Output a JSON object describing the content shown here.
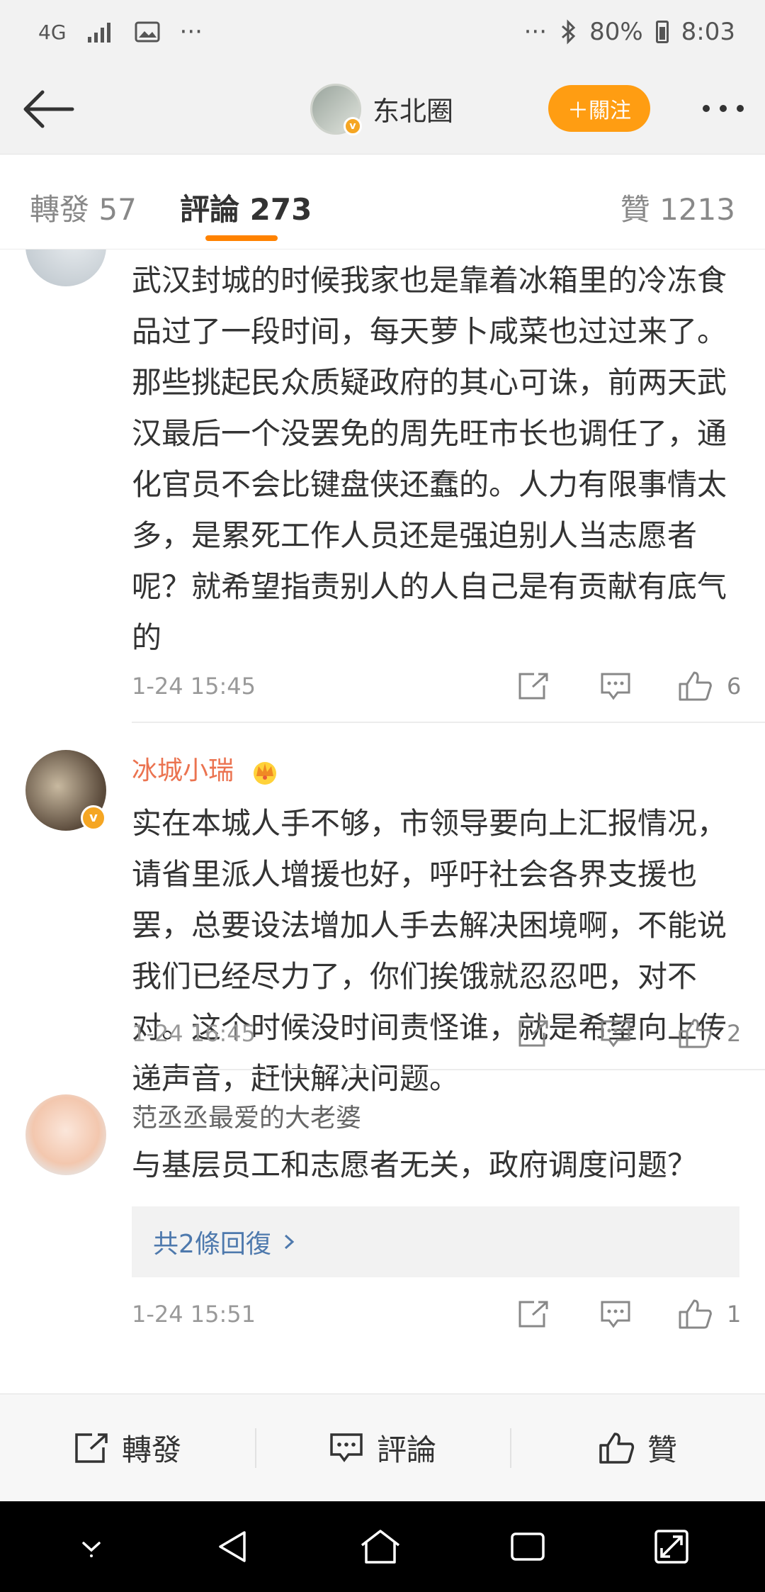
{
  "status_bar": {
    "network": "4G",
    "more_left": "···",
    "more_right": "···",
    "battery": "80%",
    "time": "8:03"
  },
  "header": {
    "group_name": "东北圈",
    "follow_label": "＋關注"
  },
  "tabs": [
    {
      "label": "轉發 57"
    },
    {
      "label": "評論 273"
    },
    {
      "label": "贊 1213"
    }
  ],
  "comments": [
    {
      "username": "",
      "text": "武汉封城的时候我家也是靠着冰箱里的冷冻食品过了一段时间，每天萝卜咸菜也过过来了。那些挑起民众质疑政府的其心可诛，前两天武汉最后一个没罢免的周先旺市长也调任了，通化官员不会比键盘侠还蠢的。人力有限事情太多，是累死工作人员还是强迫别人当志愿者呢？就希望指责别人的人自己是有贡献有底气的",
      "time": "1-24 15:45",
      "likes": "6"
    },
    {
      "username": "冰城小瑞",
      "text": "实在本城人手不够，市领导要向上汇报情况，请省里派人增援也好，呼吁社会各界支援也罢，总要设法增加人手去解决困境啊，不能说我们已经尽力了，你们挨饿就忍忍吧，对不对。这个时候没时间责怪谁，就是希望向上传递声音，赶快解决问题。",
      "time": "1-24 16:45",
      "likes": "2"
    },
    {
      "username": "范丞丞最爱的大老婆",
      "text": "与基层员工和志愿者无关，政府调度问题？",
      "replies": "共2條回復",
      "time": "1-24 15:51",
      "likes": "1"
    }
  ],
  "bottom_bar": {
    "repost": "轉發",
    "comment": "評論",
    "like": "贊"
  }
}
